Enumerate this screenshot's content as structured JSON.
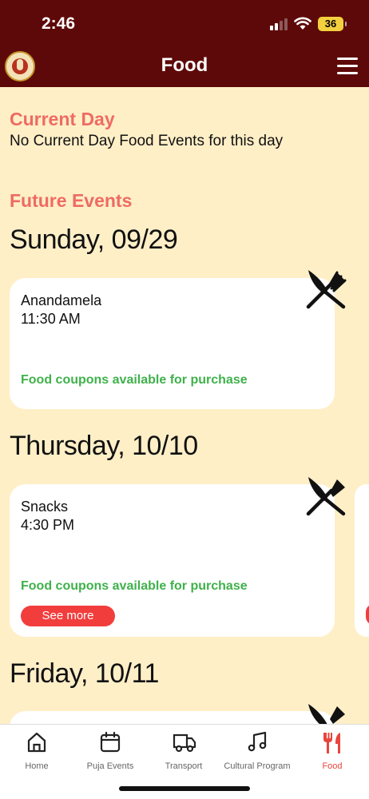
{
  "status": {
    "time": "2:46",
    "battery": "36"
  },
  "header": {
    "title": "Food"
  },
  "current_day": {
    "title": "Current Day",
    "message": "No Current Day Food Events for this day"
  },
  "future": {
    "title": "Future Events",
    "days": [
      {
        "heading": "Sunday, 09/29",
        "events": [
          {
            "name": "Anandamela",
            "time": "11:30 AM",
            "note": "Food coupons available for purchase"
          }
        ]
      },
      {
        "heading": "Thursday, 10/10",
        "events": [
          {
            "name": "Snacks",
            "time": "4:30 PM",
            "note": "Food coupons available for purchase",
            "button": "See more"
          }
        ]
      },
      {
        "heading": "Friday, 10/11",
        "events": []
      }
    ]
  },
  "tabs": [
    {
      "label": "Home",
      "icon": "home-icon"
    },
    {
      "label": "Puja Events",
      "icon": "calendar-icon"
    },
    {
      "label": "Transport",
      "icon": "truck-icon"
    },
    {
      "label": "Cultural Program",
      "icon": "music-note-icon"
    },
    {
      "label": "Food",
      "icon": "fork-knife-icon",
      "active": true
    }
  ],
  "colors": {
    "header": "#5E0909",
    "background": "#FFEFC7",
    "accent": "#EE6B63",
    "coupon_text": "#3FB14B",
    "button": "#F23D3D",
    "active_tab": "#E8453C"
  }
}
